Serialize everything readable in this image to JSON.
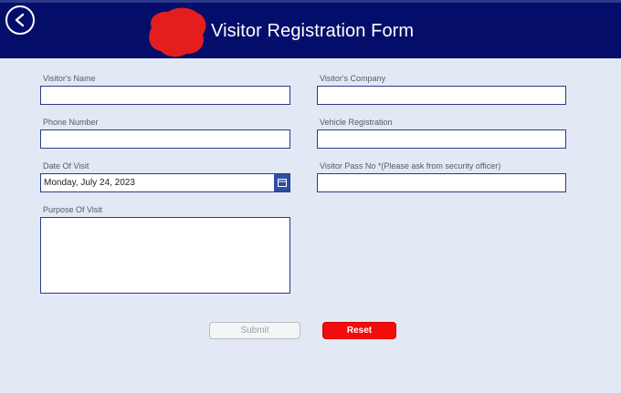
{
  "header": {
    "title": "Visitor Registration Form",
    "bg_color": "#040e6a",
    "back_icon": "chevron-left-icon",
    "logo_color": "#e41e1e"
  },
  "form": {
    "visitor_name": {
      "label": "Visitor's Name",
      "value": ""
    },
    "visitor_company": {
      "label": "Visitor's Company",
      "value": ""
    },
    "phone_number": {
      "label": "Phone Number",
      "value": ""
    },
    "vehicle_registration": {
      "label": "Vehicle Registration",
      "value": ""
    },
    "date_of_visit": {
      "label": "Date Of Visit",
      "value": "Monday, July 24, 2023",
      "icon": "calendar-icon"
    },
    "visitor_pass_no": {
      "label": "Visitor Pass No *(Please ask from security officer)",
      "value": ""
    },
    "purpose_of_visit": {
      "label": "Purpose Of Visit",
      "value": ""
    }
  },
  "actions": {
    "submit_label": "Submit",
    "reset_label": "Reset",
    "reset_color": "#f20c0c"
  }
}
